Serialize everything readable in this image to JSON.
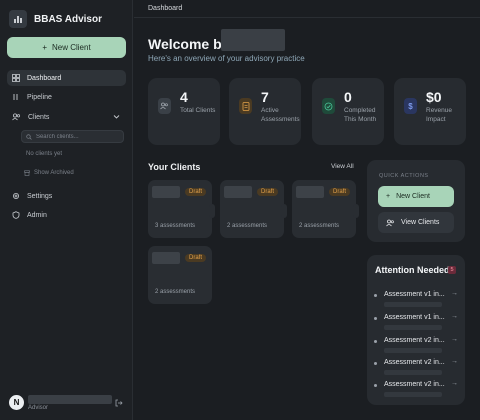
{
  "app": {
    "title": "BBAS Advisor"
  },
  "sidebar": {
    "new_client_label": "New Client",
    "nav": [
      {
        "label": "Dashboard"
      },
      {
        "label": "Pipeline"
      },
      {
        "label": "Clients"
      },
      {
        "label": "Settings"
      },
      {
        "label": "Admin"
      }
    ],
    "search_placeholder": "Search clients...",
    "empty_note": "No clients yet",
    "show_archived": "Show Archived",
    "user": {
      "role": "Advisor",
      "avatar_letter": "N"
    }
  },
  "topbar": {
    "breadcrumb": "Dashboard"
  },
  "main": {
    "welcome": "Welcome bac",
    "subtitle": "Here's an overview of your advisory practice",
    "stats": [
      {
        "value": "4",
        "label": "Total Clients",
        "color": "#8a9098"
      },
      {
        "value": "7",
        "label": "Active Assessments",
        "color": "#e3a24a"
      },
      {
        "value": "0",
        "label": "Completed This Month",
        "color": "#4bc79a"
      },
      {
        "value": "$0",
        "label": "Revenue Impact",
        "color": "#5b7bd5"
      }
    ],
    "clients_title": "Your Clients",
    "view_all": "View All",
    "clients": [
      {
        "badge": "Draft",
        "count": "3 assessments"
      },
      {
        "badge": "Draft",
        "count": "2 assessments"
      },
      {
        "badge": "Draft",
        "count": "2 assessments"
      },
      {
        "badge": "Draft",
        "count": "2 assessments"
      }
    ]
  },
  "quick_actions": {
    "title": "QUICK ACTIONS",
    "new_client": "New Client",
    "view_clients": "View Clients"
  },
  "attention": {
    "title": "Attention Needed",
    "count": "5",
    "items": [
      {
        "label": "Assessment v1 in..."
      },
      {
        "label": "Assessment v1 in..."
      },
      {
        "label": "Assessment v2 in..."
      },
      {
        "label": "Assessment v2 in..."
      },
      {
        "label": "Assessment v2 in..."
      }
    ]
  }
}
